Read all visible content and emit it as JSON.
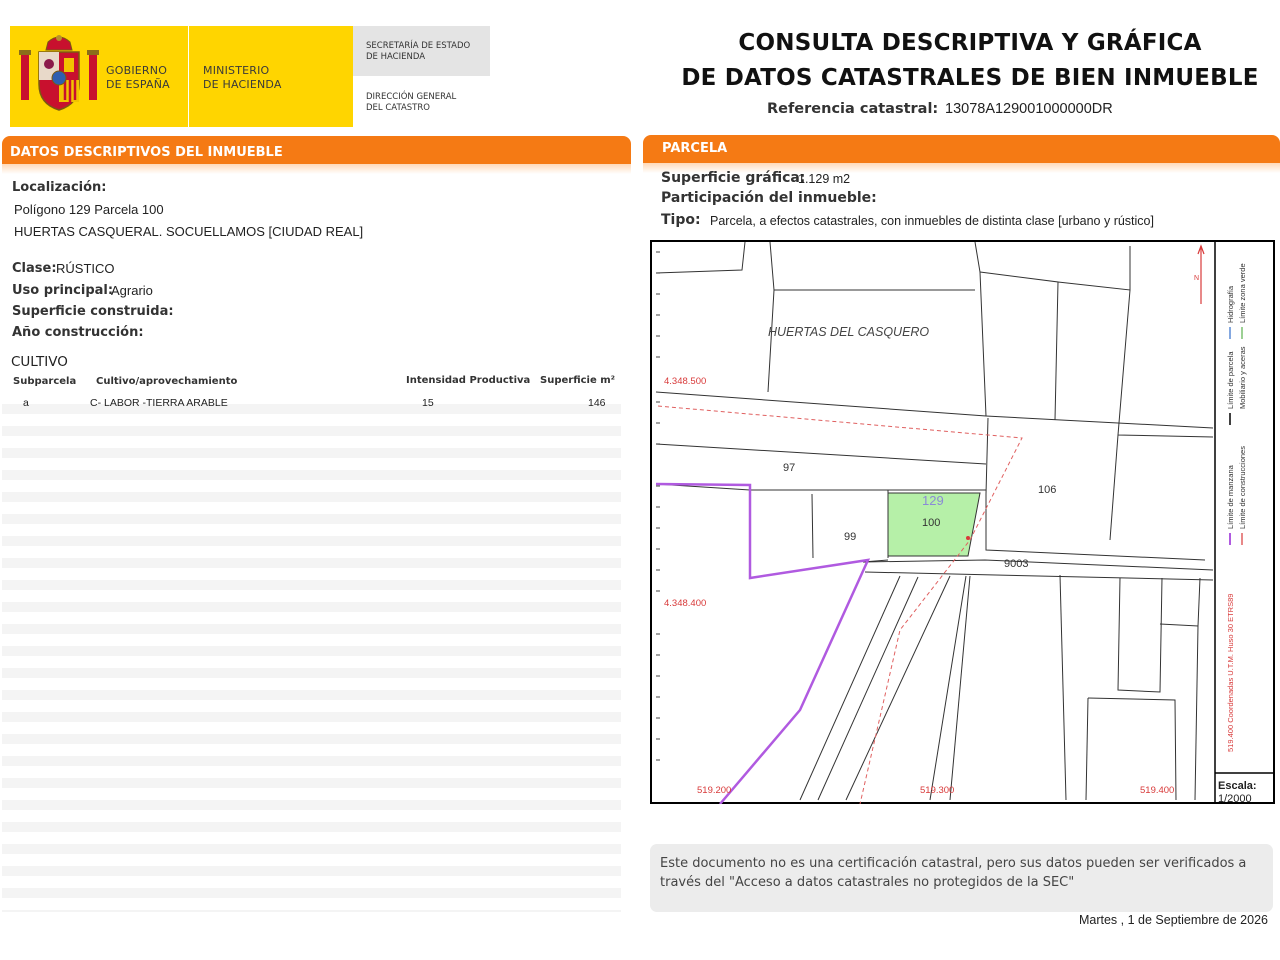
{
  "header": {
    "gov_line1": "GOBIERNO",
    "gov_line2": "DE ESPAÑA",
    "min_line1": "MINISTERIO",
    "min_line2": "DE HACIENDA",
    "sec_line1": "SECRETARÍA DE ESTADO",
    "sec_line2": "DE HACIENDA",
    "dgc_line1": "DIRECCIÓN GENERAL",
    "dgc_line2": "DEL CATASTRO",
    "title_line1": "CONSULTA DESCRIPTIVA Y GRÁFICA",
    "title_line2": "DE DATOS CATASTRALES DE BIEN INMUEBLE",
    "ref_label": "Referencia catastral:",
    "ref_value": "13078A129001000000DR"
  },
  "left": {
    "section_title": "DATOS DESCRIPTIVOS DEL INMUEBLE",
    "localizacion_label": "Localización:",
    "localizacion_line1": "Polígono 129 Parcela 100",
    "localizacion_line2": "HUERTAS CASQUERAL. SOCUELLAMOS [CIUDAD REAL]",
    "clase_label": "Clase:",
    "clase_value": "RÚSTICO",
    "uso_label": "Uso principal:",
    "uso_value": "Agrario",
    "superficie_label": "Superficie construida:",
    "anio_label": "Año construcción:",
    "cultivo_title": "CULTIVO",
    "cultivo_headers": [
      "Subparcela",
      "Cultivo/aprovechamiento",
      "Intensidad Productiva",
      "Superficie m²"
    ],
    "cultivo_rows": [
      {
        "subparcela": "a",
        "cultivo": "C- LABOR -TIERRA ARABLE",
        "intensidad": "15",
        "superficie": "146"
      }
    ]
  },
  "right": {
    "section_title": "PARCELA",
    "sup_grafica_label": "Superficie gráfica:",
    "sup_grafica_value": "1.129 m2",
    "participacion_label": "Participación del inmueble:",
    "tipo_label": "Tipo:",
    "tipo_value": "Parcela, a efectos catastrales, con inmuebles de distinta clase [urbano y rústico]"
  },
  "map": {
    "paraje": "HUERTAS DEL CASQUERO",
    "labels": {
      "p97": "97",
      "p99": "99",
      "p100": "100",
      "p106": "106",
      "p129": "129",
      "p9003": "9003"
    },
    "y_coords": [
      "4.348.500",
      "4.348.400"
    ],
    "x_coords": [
      "519.200",
      "519.300",
      "519.400"
    ],
    "scale_label": "Escala:",
    "scale_value": "1/2000",
    "legend_items": [
      "Hidrografía",
      "Límite zona verde",
      "Límite de parcela",
      "Mobiliario y aceras",
      "Límite de manzana",
      "Límite de construcciones"
    ],
    "coord_note": "519.400 Coordenadas U.T.M. Huso 30 ETRS89",
    "colors": {
      "highlight": "#b6f0a8",
      "manzana": "#b05ae0",
      "construcciones": "#e06060",
      "coords": "#d83a3a"
    }
  },
  "footer": {
    "note": "Este documento no es una certificación catastral, pero sus datos pueden ser verificados a través del \"Acceso a datos catastrales no protegidos de la SEC\"",
    "date": "Martes , 1 de Septiembre de 2026"
  }
}
